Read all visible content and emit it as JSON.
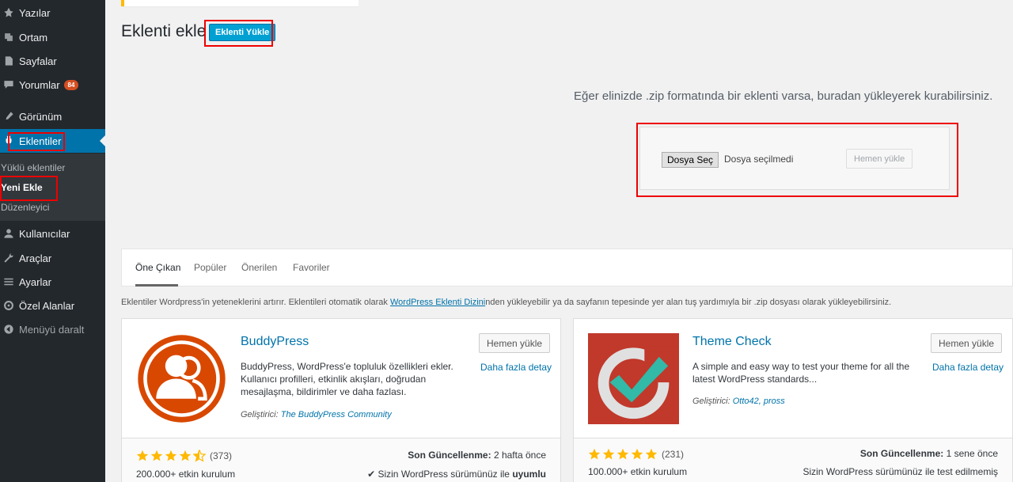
{
  "sidebar": {
    "items": [
      {
        "label": "Yazılar",
        "icon": "pin-icon"
      },
      {
        "label": "Ortam",
        "icon": "media-icon"
      },
      {
        "label": "Sayfalar",
        "icon": "pages-icon"
      },
      {
        "label": "Yorumlar",
        "icon": "comments-icon",
        "badge": "84"
      },
      {
        "label": "Görünüm",
        "icon": "appearance-icon"
      },
      {
        "label": "Eklentiler",
        "icon": "plugins-icon"
      },
      {
        "label": "Kullanıcılar",
        "icon": "users-icon"
      },
      {
        "label": "Araçlar",
        "icon": "tools-icon"
      },
      {
        "label": "Ayarlar",
        "icon": "settings-icon"
      },
      {
        "label": "Özel Alanlar",
        "icon": "custom-fields-icon"
      },
      {
        "label": "Menüyü daralt",
        "icon": "collapse-icon"
      }
    ],
    "submenu": [
      "Yüklü eklentiler",
      "Yeni Ekle",
      "Düzenleyici"
    ]
  },
  "header": {
    "title": "Eklenti ekle",
    "upload_button": "Eklenti Yükle"
  },
  "upload": {
    "help_text": "Eğer elinizde .zip formatında bir eklenti varsa, buradan yükleyerek kurabilirsiniz.",
    "choose_file": "Dosya Seç",
    "no_file": "Dosya seçilmedi",
    "install_now": "Hemen yükle"
  },
  "tabs": [
    "Öne Çıkan",
    "Popüler",
    "Önerilen",
    "Favoriler"
  ],
  "description": {
    "before": "Eklentiler Wordpress'in yeteneklerini artırır. Eklentileri otomatik olarak ",
    "link": "WordPress Eklenti Dizini",
    "after": "nden yükleyebilir ya da sayfanın tepesinde yer alan tuş yardımıyla bir .zip dosyası olarak yükleyebilirsiniz."
  },
  "plugins": [
    {
      "name": "BuddyPress",
      "description": "BuddyPress, WordPress'e topluluk özellikleri ekler. Kullanıcı profilleri, etkinlik akışları, doğrudan mesajlaşma, bildirimler ve daha fazlası.",
      "author_label": "Geliştirici:",
      "author": "The BuddyPress Community",
      "install": "Hemen yükle",
      "more": "Daha fazla detay",
      "rating": 4.5,
      "rating_count": "(373)",
      "installs": "200.000+ etkin kurulum",
      "updated_label": "Son Güncellenme:",
      "updated_value": "2 hafta önce",
      "compat_text": "Sizin WordPress sürümünüz ile",
      "compat_bold": "uyumlu",
      "compat_mark": "✔"
    },
    {
      "name": "Theme Check",
      "description": "A simple and easy way to test your theme for all the latest WordPress standards...",
      "author_label": "Geliştirici:",
      "author": "Otto42, pross",
      "install": "Hemen yükle",
      "more": "Daha fazla detay",
      "rating": 5,
      "rating_count": "(231)",
      "installs": "100.000+ etkin kurulum",
      "updated_label": "Son Güncellenme:",
      "updated_value": "1 sene önce",
      "compat_text": "Sizin WordPress sürümünüz ile test edilmemiş",
      "compat_bold": "",
      "compat_mark": ""
    }
  ],
  "colors": {
    "sidebar_bg": "#23282d",
    "active": "#0073aa",
    "primary_button": "#00a0d2",
    "link": "#0073aa",
    "star": "#ffb900",
    "buddypress": "#d84800",
    "themecheck_bg": "#c0392b",
    "themecheck_check": "#32b9a7",
    "highlight": "#e00000"
  }
}
